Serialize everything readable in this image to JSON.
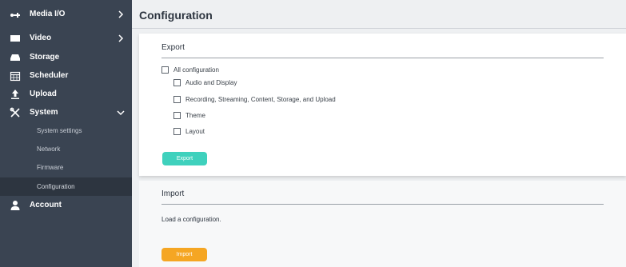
{
  "sidebar": {
    "items": [
      {
        "label": "Media I/O",
        "icon": "media-io-icon",
        "has_chevron": true
      },
      {
        "label": "Video",
        "icon": "video-icon",
        "has_chevron": true
      },
      {
        "label": "Storage",
        "icon": "storage-icon",
        "has_chevron": false
      },
      {
        "label": "Scheduler",
        "icon": "calendar-icon",
        "has_chevron": false
      },
      {
        "label": "Upload",
        "icon": "upload-icon",
        "has_chevron": false
      },
      {
        "label": "System",
        "icon": "tools-icon",
        "has_chevron": true,
        "expanded": true
      },
      {
        "label": "Account",
        "icon": "user-icon",
        "has_chevron": false
      }
    ],
    "system_subitems": [
      {
        "label": "System settings"
      },
      {
        "label": "Network"
      },
      {
        "label": "Firmware"
      },
      {
        "label": "Configuration",
        "active": true
      }
    ]
  },
  "page": {
    "title": "Configuration"
  },
  "export": {
    "title": "Export",
    "options": [
      {
        "label": "All configuration",
        "checked": false
      },
      {
        "label": "Audio and Display",
        "checked": false
      },
      {
        "label": "Recording, Streaming, Content, Storage, and Upload",
        "checked": false
      },
      {
        "label": "Theme",
        "checked": false
      },
      {
        "label": "Layout",
        "checked": false
      }
    ],
    "button_label": "Export"
  },
  "import": {
    "title": "Import",
    "description": "Load a configuration.",
    "button_label": "Import"
  },
  "colors": {
    "sidebar_bg": "#3a4452",
    "sidebar_active_bg": "#2d3540",
    "export_button": "#3fd1bd",
    "import_button": "#f5a623",
    "content_bg": "#eef0f2"
  }
}
